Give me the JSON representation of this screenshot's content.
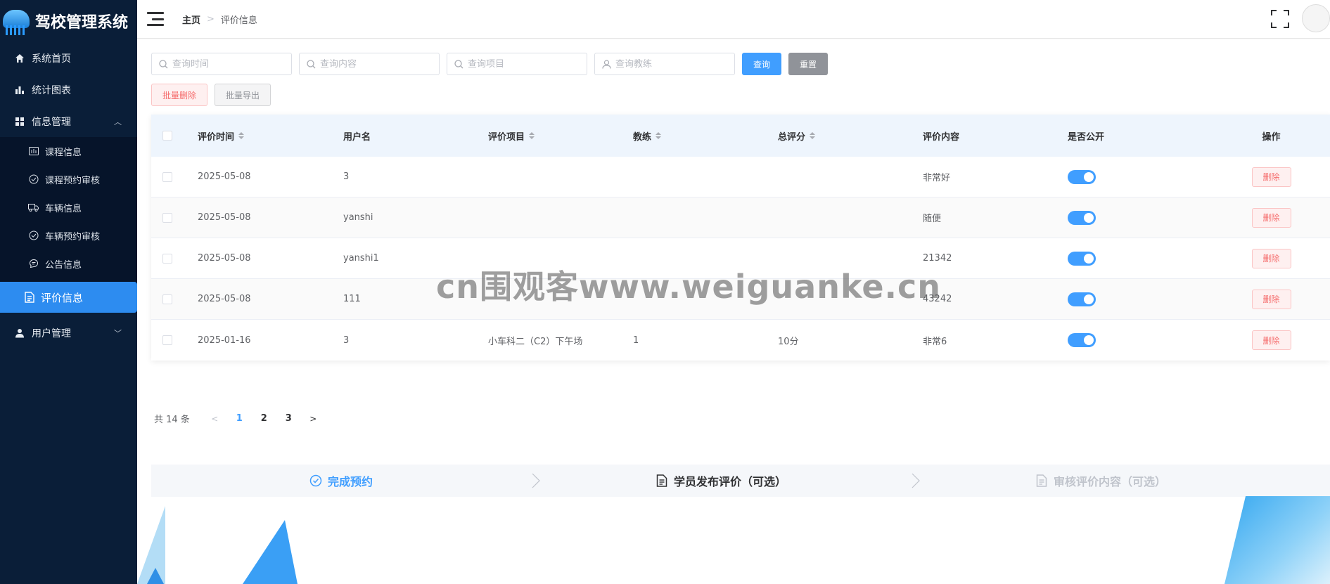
{
  "app": {
    "title": "驾校管理系统"
  },
  "sidebar": {
    "items": [
      {
        "label": "系统首页",
        "icon": "home-icon"
      },
      {
        "label": "统计图表",
        "icon": "bar-chart-icon"
      },
      {
        "label": "信息管理",
        "icon": "grid-icon",
        "expanded": true
      },
      {
        "label": "用户管理",
        "icon": "user-icon",
        "expanded": false
      }
    ],
    "sub_items": [
      {
        "label": "课程信息",
        "icon": "course-icon"
      },
      {
        "label": "课程预约审核",
        "icon": "check-circle-icon"
      },
      {
        "label": "车辆信息",
        "icon": "truck-icon"
      },
      {
        "label": "车辆预约审核",
        "icon": "check-circle-icon"
      },
      {
        "label": "公告信息",
        "icon": "chat-icon"
      },
      {
        "label": "评价信息",
        "icon": "document-icon",
        "active": true
      }
    ]
  },
  "header": {
    "breadcrumb_home": "主页",
    "breadcrumb_sep": ">",
    "breadcrumb_current": "评价信息"
  },
  "search": {
    "time_placeholder": "查询时间",
    "content_placeholder": "查询内容",
    "item_placeholder": "查询项目",
    "coach_placeholder": "查询教练",
    "query_label": "查询",
    "reset_label": "重置",
    "batch_delete_label": "批量删除",
    "batch_export_label": "批量导出"
  },
  "table": {
    "headers": {
      "time": "评价时间",
      "user": "用户名",
      "item": "评价项目",
      "coach": "教练",
      "score": "总评分",
      "content": "评价内容",
      "public": "是否公开",
      "op": "操作"
    },
    "rows": [
      {
        "time": "2025-05-08",
        "user": "3",
        "item": "",
        "coach": "",
        "score": "",
        "content": "非常好",
        "public": true,
        "delete": "删除"
      },
      {
        "time": "2025-05-08",
        "user": "yanshi",
        "item": "",
        "coach": "",
        "score": "",
        "content": "随便",
        "public": true,
        "delete": "删除"
      },
      {
        "time": "2025-05-08",
        "user": "yanshi1",
        "item": "",
        "coach": "",
        "score": "",
        "content": "21342",
        "public": true,
        "delete": "删除"
      },
      {
        "time": "2025-05-08",
        "user": "111",
        "item": "",
        "coach": "",
        "score": "",
        "content": "43242",
        "public": true,
        "delete": "删除"
      },
      {
        "time": "2025-01-16",
        "user": "3",
        "item": "小车科二（C2）下午场",
        "coach": "1",
        "score": "10分",
        "content": "非常6",
        "public": true,
        "delete": "删除"
      }
    ]
  },
  "pagination": {
    "total": "共 14 条",
    "pages": [
      "1",
      "2",
      "3"
    ],
    "current": "1"
  },
  "steps": [
    {
      "label": "完成预约",
      "status": "done",
      "icon": "check-circle-icon"
    },
    {
      "label": "学员发布评价（可选）",
      "status": "process",
      "icon": "document-icon"
    },
    {
      "label": "审核评价内容（可选）",
      "status": "wait",
      "icon": "document-icon"
    }
  ],
  "watermark": "cn围观客www.weiguanke.cn",
  "colors": {
    "primary": "#409eff",
    "sidebar": "#0a1e38",
    "active_menu": "#2d8cf0",
    "danger": "#f56c6c"
  }
}
